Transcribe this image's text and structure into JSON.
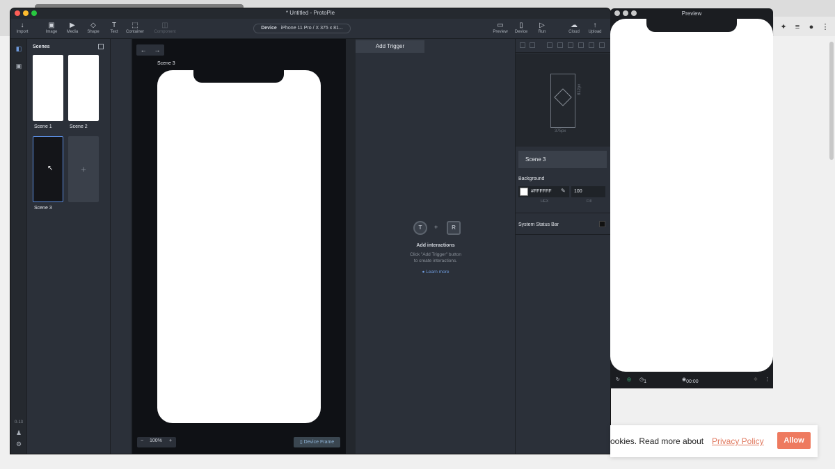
{
  "app": {
    "title": "* Untitled - ProtoPie",
    "toolbar_left": [
      {
        "label": "Import",
        "icon": "↓"
      },
      {
        "label": "Image",
        "icon": "▣"
      },
      {
        "label": "Media",
        "icon": "▶"
      },
      {
        "label": "Shape",
        "icon": "◇"
      },
      {
        "label": "Text",
        "icon": "T"
      },
      {
        "label": "Container",
        "icon": "⬚"
      },
      {
        "label": "Component",
        "icon": "◫"
      }
    ],
    "device_pill": {
      "label": "Device",
      "value": "iPhone 11 Pro / X  375 x 81..."
    },
    "toolbar_right": [
      {
        "label": "Preview",
        "icon": "▭"
      },
      {
        "label": "Device",
        "icon": "▯"
      },
      {
        "label": "Run",
        "icon": "▷"
      },
      {
        "label": "Cloud",
        "icon": "☁"
      },
      {
        "label": "Upload",
        "icon": "↑"
      }
    ],
    "version": "0-13"
  },
  "scenes_panel": {
    "title": "Scenes",
    "scenes": [
      {
        "name": "Scene 1"
      },
      {
        "name": "Scene 2"
      },
      {
        "name": "Scene 3"
      }
    ],
    "add_icon": "+"
  },
  "canvas": {
    "scene_name": "Scene 3",
    "zoom": "100%",
    "zoom_minus": "−",
    "zoom_plus": "+",
    "device_frame": "Device Frame",
    "nav_back": "←",
    "nav_forward": "→"
  },
  "interactions": {
    "add_trigger": "Add Trigger",
    "trigger_letter": "T",
    "response_letter": "R",
    "plus": "+",
    "title": "Add interactions",
    "line1": "Click \"Add Trigger\" button",
    "line2": "to create interactions.",
    "learn_more": "Learn more"
  },
  "properties": {
    "preview_width": "375px",
    "preview_height": "812px",
    "scene_name": "Scene 3",
    "background_label": "Background",
    "hex_value": "#FFFFFF",
    "fill_value": "100",
    "hex_caption": "HEX",
    "fill_caption": "Fill",
    "status_bar_label": "System Status Bar"
  },
  "preview_window": {
    "title": "Preview",
    "time": "00:00",
    "speed": "1"
  },
  "cookie": {
    "text": "ookies. Read more about",
    "link": "Privacy Policy",
    "button": "Allow"
  },
  "colors": {
    "accent": "#ee7a5f",
    "selected_border": "#5b8de0",
    "link": "#6f9bdd"
  }
}
